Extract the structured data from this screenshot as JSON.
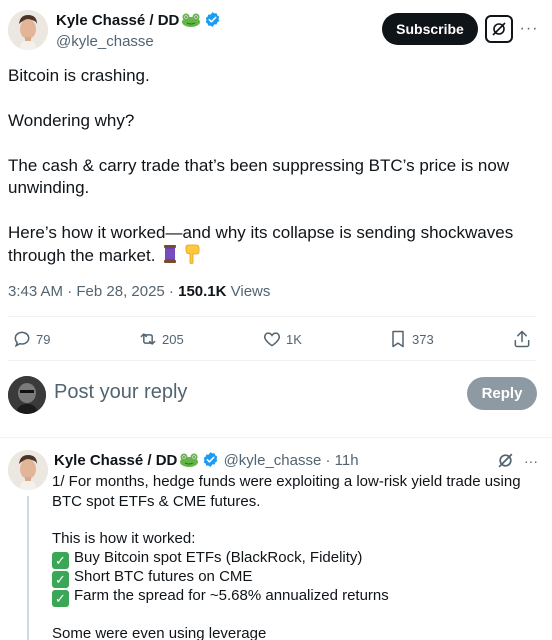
{
  "author": {
    "name": "Kyle Chassé / DD",
    "handle": "@kyle_chasse"
  },
  "header": {
    "subscribe_label": "Subscribe",
    "more_label": "···"
  },
  "tweet": {
    "lines": [
      "Bitcoin is crashing.",
      "Wondering why?",
      "The cash & carry trade that’s been suppressing BTC’s price is now unwinding.",
      "Here’s how it worked—and why its collapse is sending shockwaves through the market."
    ],
    "time": "3:43 AM · Feb 28, 2025 · ",
    "views_count": "150.1K",
    "views_label": " Views"
  },
  "actions": {
    "replies": "79",
    "reposts": "205",
    "likes": "1K",
    "bookmarks": "373"
  },
  "composer": {
    "placeholder": "Post your reply",
    "reply_label": "Reply"
  },
  "reply": {
    "name": "Kyle Chassé / DD",
    "handle": "@kyle_chasse",
    "age": "· 11h",
    "line1": "1/ For months, hedge funds were exploiting a low-risk yield trade using BTC spot ETFs & CME futures.",
    "line2": "This is how it worked:",
    "items": [
      "Buy Bitcoin spot ETFs (BlackRock, Fidelity)",
      "Short BTC futures on CME",
      "Farm the spread for ~5.68% annualized returns"
    ],
    "line3": "Some were even using leverage"
  },
  "colors": {
    "text": "#0f1419",
    "secondary": "#536471",
    "verified": "#1d9bf0",
    "check": "#3aa757"
  }
}
